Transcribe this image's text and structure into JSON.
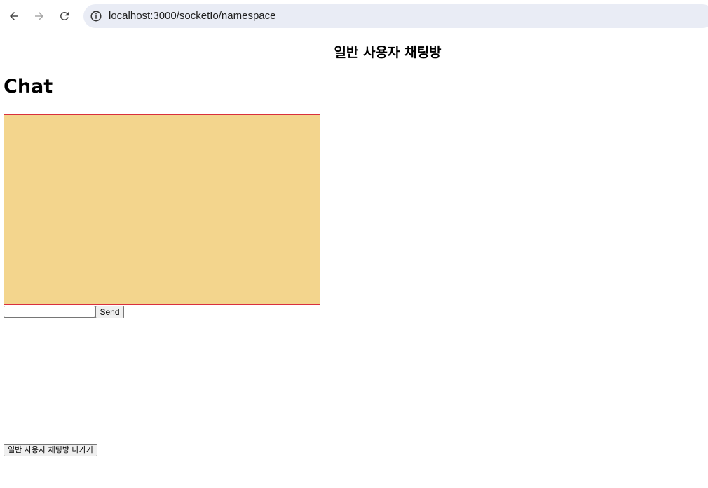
{
  "browser": {
    "url": "localhost:3000/socketIo/namespace"
  },
  "page": {
    "room_title": "일반 사용자 채팅방",
    "chat_heading": "Chat",
    "chat_messages": [],
    "message_input_value": "",
    "send_label": "Send",
    "leave_label": "일반 사용자 채팅방 나가기"
  },
  "colors": {
    "chat_box_bg": "#f3d58d",
    "chat_box_border": "#d9303d",
    "address_bar_bg": "#e9ecf5"
  }
}
